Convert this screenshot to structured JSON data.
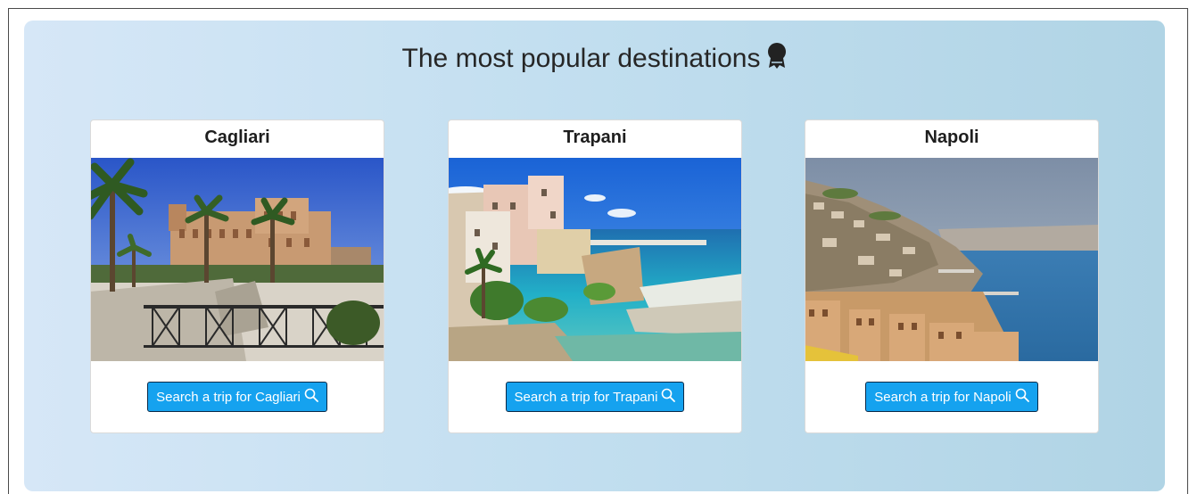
{
  "header": {
    "title": "The most popular destinations",
    "title_icon": "award-icon"
  },
  "destinations": [
    {
      "name": "Cagliari",
      "button_label": "Search a trip for Cagliari",
      "button_icon": "search-icon"
    },
    {
      "name": "Trapani",
      "button_label": "Search a trip for Trapani",
      "button_icon": "search-icon"
    },
    {
      "name": "Napoli",
      "button_label": "Search a trip for Napoli",
      "button_icon": "search-icon"
    }
  ],
  "colors": {
    "panel_start": "#d6e7f7",
    "panel_end": "#b0d4e5",
    "button_bg": "#15a2ef",
    "button_border": "#0b2a48"
  }
}
